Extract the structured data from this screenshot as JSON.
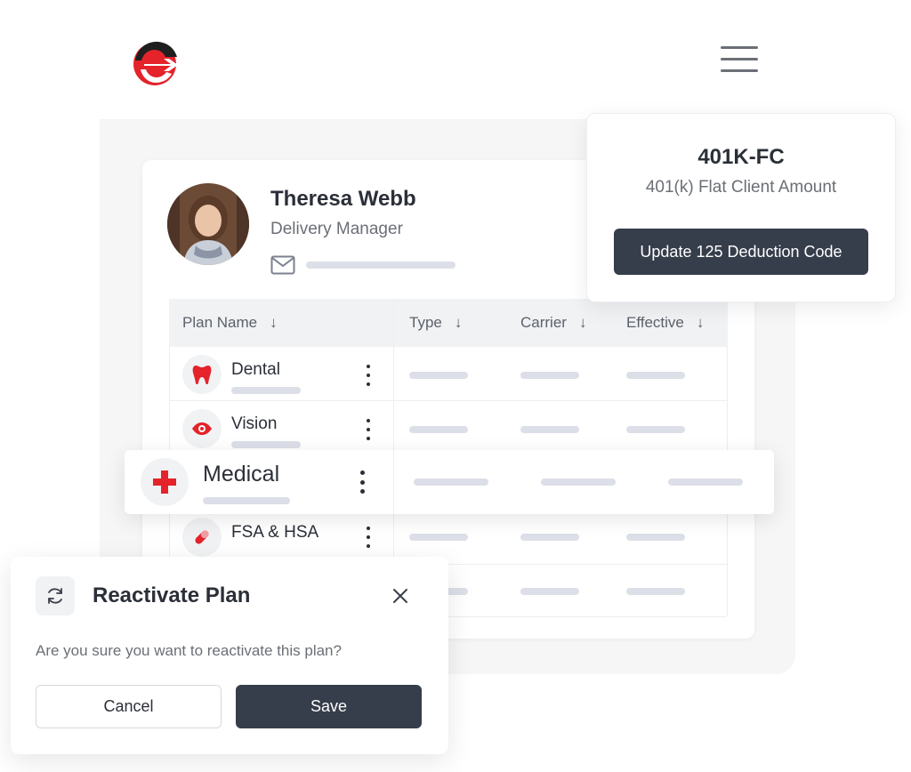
{
  "colors": {
    "brand_red": "#e4232a",
    "brand_dark": "#1f1f1f",
    "primary_button": "#363d4b",
    "skeleton": "#dcdfe8"
  },
  "header": {
    "logo_icon": "e-logo-icon",
    "menu_icon": "hamburger-menu-icon"
  },
  "profile": {
    "name": "Theresa Webb",
    "title": "Delivery Manager",
    "email_icon": "mail-icon",
    "avatar_icon": "avatar"
  },
  "table": {
    "columns": [
      {
        "label": "Plan Name",
        "sort_icon": "arrow-down-icon"
      },
      {
        "label": "Type",
        "sort_icon": "arrow-down-icon"
      },
      {
        "label": "Carrier",
        "sort_icon": "arrow-down-icon"
      },
      {
        "label": "Effective",
        "sort_icon": "arrow-down-icon"
      }
    ],
    "rows": [
      {
        "name": "Dental",
        "icon": "tooth-icon"
      },
      {
        "name": "Vision",
        "icon": "eye-icon"
      },
      {
        "name": "Medical",
        "icon": "medical-cross-icon"
      },
      {
        "name": "FSA & HSA",
        "icon": "pill-icon"
      }
    ]
  },
  "deduction_card": {
    "code": "401K-FC",
    "description": "401(k) Flat Client Amount",
    "button_label": "Update 125 Deduction Code"
  },
  "dialog": {
    "title": "Reactivate Plan",
    "icon": "refresh-icon",
    "message": "Are you sure you want to reactivate this plan?",
    "cancel_label": "Cancel",
    "save_label": "Save",
    "close_icon": "close-icon"
  }
}
